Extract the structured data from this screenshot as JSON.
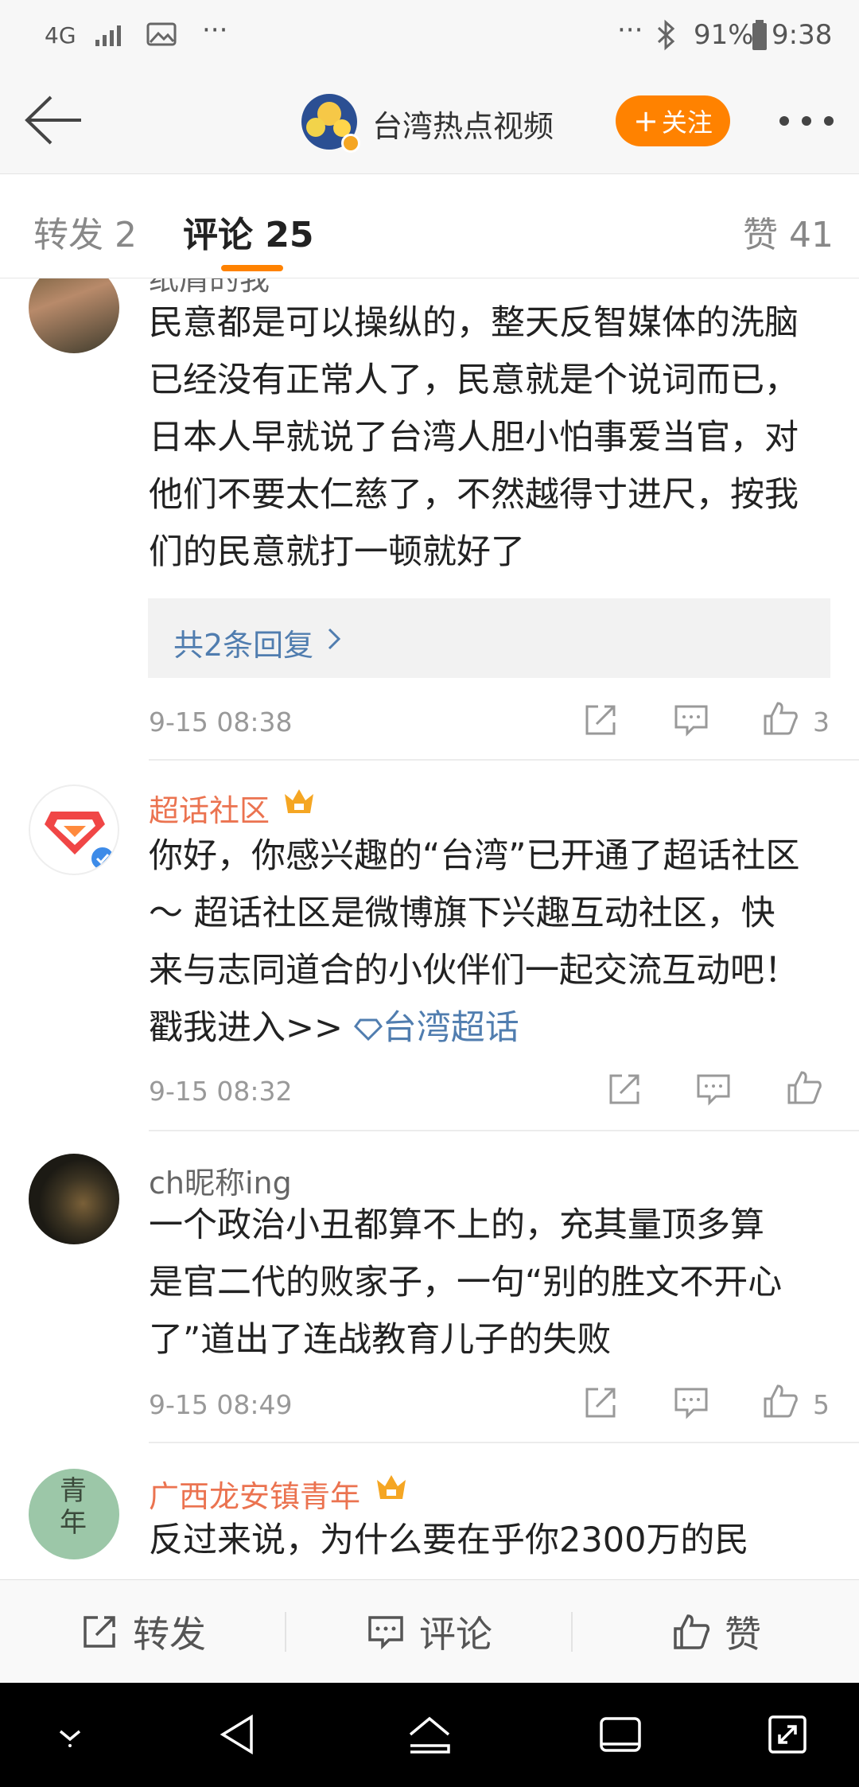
{
  "status_bar": {
    "network": "4G",
    "battery": "91%",
    "time": "9:38",
    "more_left": "···",
    "more_right": "···"
  },
  "header": {
    "title": "台湾热点视频",
    "follow_label": "关注"
  },
  "tabs": [
    {
      "label": "转发 2"
    },
    {
      "label": "评论 25"
    },
    {
      "label": "赞 41"
    }
  ],
  "comments": [
    {
      "username": "纸屑的我",
      "text": [
        "民意都是可以操纵的，整天反智媒体的洗脑",
        "已经没有正常人了，民意就是个说词而已，",
        "日本人早就说了台湾人胆小怕事爱当官，对",
        "他们不要太仁慈了，不然越得寸进尺，按我",
        "们的民意就打一顿就好了"
      ],
      "replies": "共2条回复",
      "time": "9-15 08:38",
      "likes": "3"
    },
    {
      "username": "超话社区",
      "text": [
        "你好，你感兴趣的“台湾”已开通了超话社区",
        "～ 超话社区是微博旗下兴趣互动社区，快",
        "来与志同道合的小伙伴们一起交流互动吧！"
      ],
      "cta": "戳我进入>>",
      "link": "台湾超话",
      "time": "9-15 08:32",
      "likes": ""
    },
    {
      "username": "ch昵称ing",
      "text": [
        "一个政治小丑都算不上的，充其量顶多算",
        "是官二代的败家子，一句“别的胜文不开心",
        "了”道出了连战教育儿子的失败"
      ],
      "time": "9-15 08:49",
      "likes": "5"
    },
    {
      "username": "广西龙安镇青年",
      "avatar_text": "青年",
      "text": [
        "反过来说，为什么要在乎你2300万的民"
      ]
    }
  ],
  "bottom_bar": {
    "repost": "转发",
    "comment": "评论",
    "like": "赞"
  },
  "colors": {
    "accent": "#ff8200",
    "username_orange": "#eb7350",
    "link": "#507daf"
  }
}
